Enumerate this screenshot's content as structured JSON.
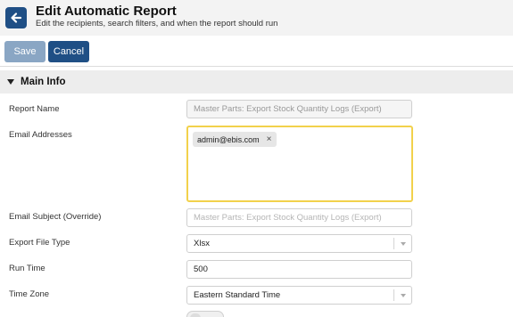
{
  "header": {
    "title": "Edit Automatic Report",
    "subtitle": "Edit the recipients, search filters, and when the report should run"
  },
  "toolbar": {
    "save_label": "Save",
    "cancel_label": "Cancel"
  },
  "section": {
    "title": "Main Info"
  },
  "form": {
    "report_name": {
      "label": "Report Name",
      "value": "Master Parts: Export Stock Quantity Logs (Export)"
    },
    "email_addresses": {
      "label": "Email Addresses",
      "tags": [
        "admin@ebis.com"
      ],
      "remove_glyph": "×"
    },
    "email_subject": {
      "label": "Email Subject (Override)",
      "placeholder": "Master Parts: Export Stock Quantity Logs (Export)"
    },
    "export_file_type": {
      "label": "Export File Type",
      "value": "Xlsx"
    },
    "run_time": {
      "label": "Run Time",
      "value": "500"
    },
    "time_zone": {
      "label": "Time Zone",
      "value": "Eastern Standard Time"
    }
  },
  "colors": {
    "primary": "#1f4f85",
    "primary_disabled": "#8aa6c4",
    "focus_border": "#f2d14b"
  },
  "icons": {
    "back": "arrow-left-icon",
    "section_toggle": "caret-down-icon",
    "select": "chevron-down-icon",
    "tag_remove": "close-icon"
  }
}
